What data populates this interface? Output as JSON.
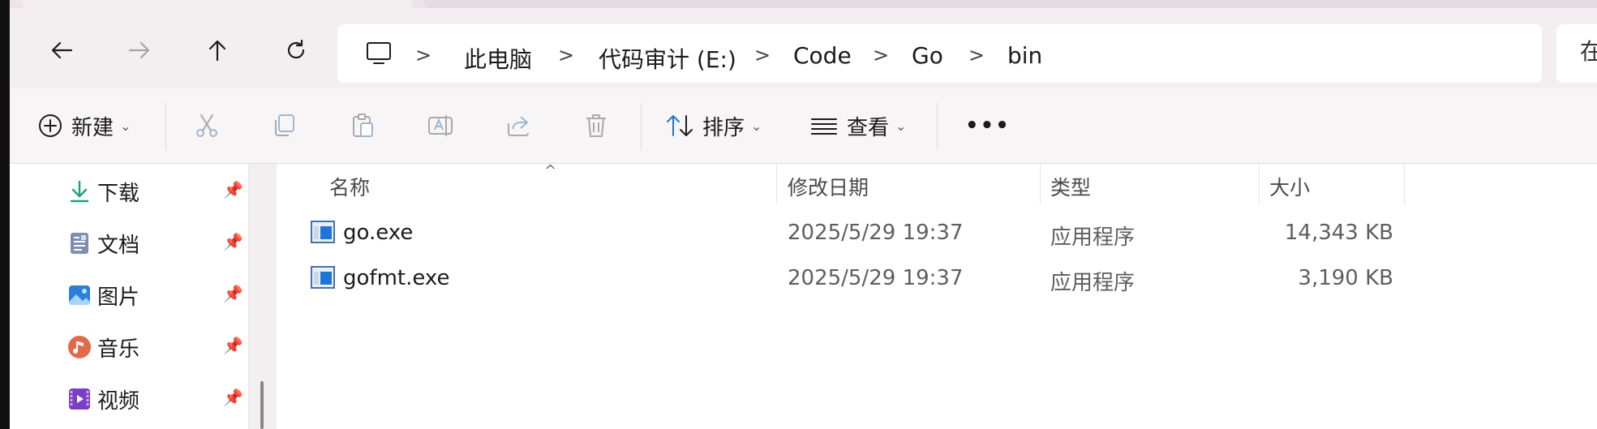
{
  "navigation": {
    "back_icon": "arrow-left-icon",
    "forward_icon": "arrow-right-icon",
    "up_icon": "arrow-up-icon",
    "refresh_icon": "refresh-icon"
  },
  "breadcrumb": {
    "root_icon": "computer-icon",
    "items": [
      "此电脑",
      "代码审计 (E:)",
      "Code",
      "Go",
      "bin"
    ],
    "separator": ">"
  },
  "search": {
    "partial_text": "在"
  },
  "toolbar": {
    "new_label": "新建",
    "sort_label": "排序",
    "view_label": "查看",
    "more_label": "•••"
  },
  "sidebar": {
    "items": [
      {
        "label": "下载",
        "icon": "download-icon"
      },
      {
        "label": "文档",
        "icon": "document-icon"
      },
      {
        "label": "图片",
        "icon": "pictures-icon"
      },
      {
        "label": "音乐",
        "icon": "music-icon"
      },
      {
        "label": "视频",
        "icon": "video-icon"
      }
    ]
  },
  "table": {
    "columns": {
      "name": "名称",
      "modified": "修改日期",
      "type": "类型",
      "size": "大小"
    },
    "rows": [
      {
        "name": "go.exe",
        "modified": "2025/5/29 19:37",
        "type": "应用程序",
        "size": "14,343 KB"
      },
      {
        "name": "gofmt.exe",
        "modified": "2025/5/29 19:37",
        "type": "应用程序",
        "size": "3,190 KB"
      }
    ]
  },
  "colors": {
    "accent": "#1f74d8",
    "navbar_bg": "#f3eff1",
    "toolbar_bg": "#f8f5f7"
  }
}
